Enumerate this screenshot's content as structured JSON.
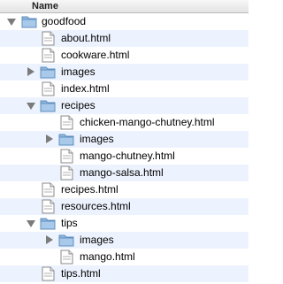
{
  "header": {
    "column_name": "Name"
  },
  "rows": [
    {
      "label": "goodfood",
      "type": "folder",
      "expanded": true
    },
    {
      "label": "about.html",
      "type": "file"
    },
    {
      "label": "cookware.html",
      "type": "file"
    },
    {
      "label": "images",
      "type": "folder",
      "expanded": false
    },
    {
      "label": "index.html",
      "type": "file"
    },
    {
      "label": "recipes",
      "type": "folder",
      "expanded": true
    },
    {
      "label": "chicken-mango-chutney.html",
      "type": "file"
    },
    {
      "label": "images",
      "type": "folder",
      "expanded": false
    },
    {
      "label": "mango-chutney.html",
      "type": "file"
    },
    {
      "label": "mango-salsa.html",
      "type": "file"
    },
    {
      "label": "recipes.html",
      "type": "file"
    },
    {
      "label": "resources.html",
      "type": "file"
    },
    {
      "label": "tips",
      "type": "folder",
      "expanded": true
    },
    {
      "label": "images",
      "type": "folder",
      "expanded": false
    },
    {
      "label": "mango.html",
      "type": "file"
    },
    {
      "label": "tips.html",
      "type": "file"
    }
  ]
}
